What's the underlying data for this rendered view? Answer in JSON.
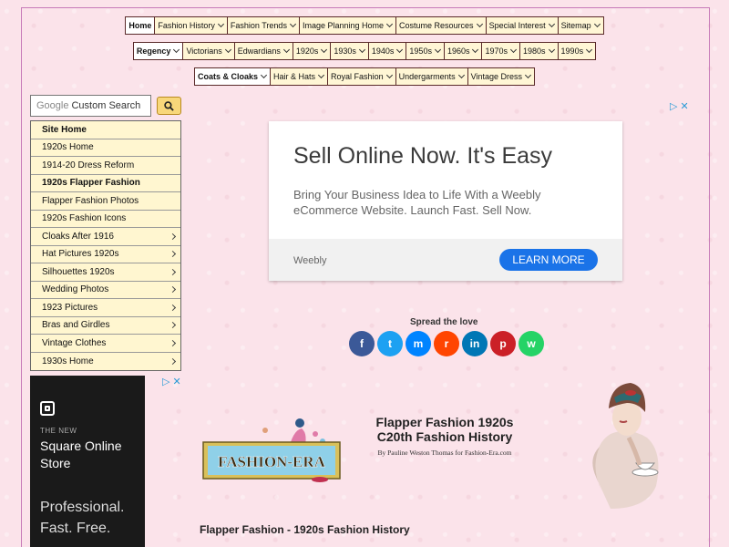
{
  "nav": {
    "row1": [
      "Home",
      "Fashion History",
      "Fashion Trends",
      "Image Planning Home",
      "Costume Resources",
      "Special Interest",
      "Sitemap"
    ],
    "row2": [
      "Regency",
      "Victorians",
      "Edwardians",
      "1920s",
      "1930s",
      "1940s",
      "1950s",
      "1960s",
      "1970s",
      "1980s",
      "1990s"
    ],
    "row3": [
      "Coats & Cloaks",
      "Hair & Hats",
      "Royal Fashion",
      "Undergarments",
      "Vintage Dress"
    ]
  },
  "search": {
    "brand": "Google",
    "placeholder": "Custom Search"
  },
  "sidebar": {
    "items": [
      {
        "label": "Site Home",
        "arrow": false
      },
      {
        "label": "1920s Home",
        "arrow": false
      },
      {
        "label": "1914-20 Dress Reform",
        "arrow": false
      },
      {
        "label": "1920s Flapper Fashion",
        "arrow": false
      },
      {
        "label": "Flapper Fashion Photos",
        "arrow": false
      },
      {
        "label": "1920s Fashion Icons",
        "arrow": false
      },
      {
        "label": "Cloaks After 1916",
        "arrow": true
      },
      {
        "label": "Hat Pictures 1920s",
        "arrow": true
      },
      {
        "label": "Silhouettes 1920s",
        "arrow": true
      },
      {
        "label": "Wedding Photos",
        "arrow": true
      },
      {
        "label": "1923 Pictures",
        "arrow": true
      },
      {
        "label": "Bras and Girdles",
        "arrow": true
      },
      {
        "label": "Vintage Clothes",
        "arrow": true
      },
      {
        "label": "1930s Home",
        "arrow": true
      }
    ]
  },
  "ad_main": {
    "headline": "Sell Online Now. It's Easy",
    "body": "Bring Your Business Idea to Life With a Weebly eCommerce Website. Launch Fast. Sell Now.",
    "brand": "Weebly",
    "cta": "LEARN MORE"
  },
  "share": {
    "label": "Spread the love",
    "buttons": [
      {
        "name": "facebook",
        "glyph": "f",
        "color": "#3b5998"
      },
      {
        "name": "twitter",
        "glyph": "t",
        "color": "#1da1f2"
      },
      {
        "name": "messenger",
        "glyph": "m",
        "color": "#0084ff"
      },
      {
        "name": "reddit",
        "glyph": "r",
        "color": "#ff4500"
      },
      {
        "name": "linkedin",
        "glyph": "in",
        "color": "#0077b5"
      },
      {
        "name": "pinterest",
        "glyph": "p",
        "color": "#cb2027"
      },
      {
        "name": "whatsapp",
        "glyph": "w",
        "color": "#25d366"
      }
    ]
  },
  "ad_side": {
    "eyebrow": "THE NEW",
    "title": "Square Online Store",
    "tagline": "Professional. Fast. Free."
  },
  "header": {
    "logo_text": "FASHION-ERA",
    "title_line1": "Flapper Fashion 1920s",
    "title_line2": "C20th Fashion History",
    "byline": "By Pauline Weston Thomas for Fashion-Era.com"
  },
  "article": {
    "heading": "Flapper Fashion - 1920s Fashion History"
  },
  "colors": {
    "nav_bg": "#fff6d5",
    "sidebar_bg": "#fff6d0",
    "page_bg": "#fbe3ea",
    "cta_blue": "#1a73e8"
  }
}
